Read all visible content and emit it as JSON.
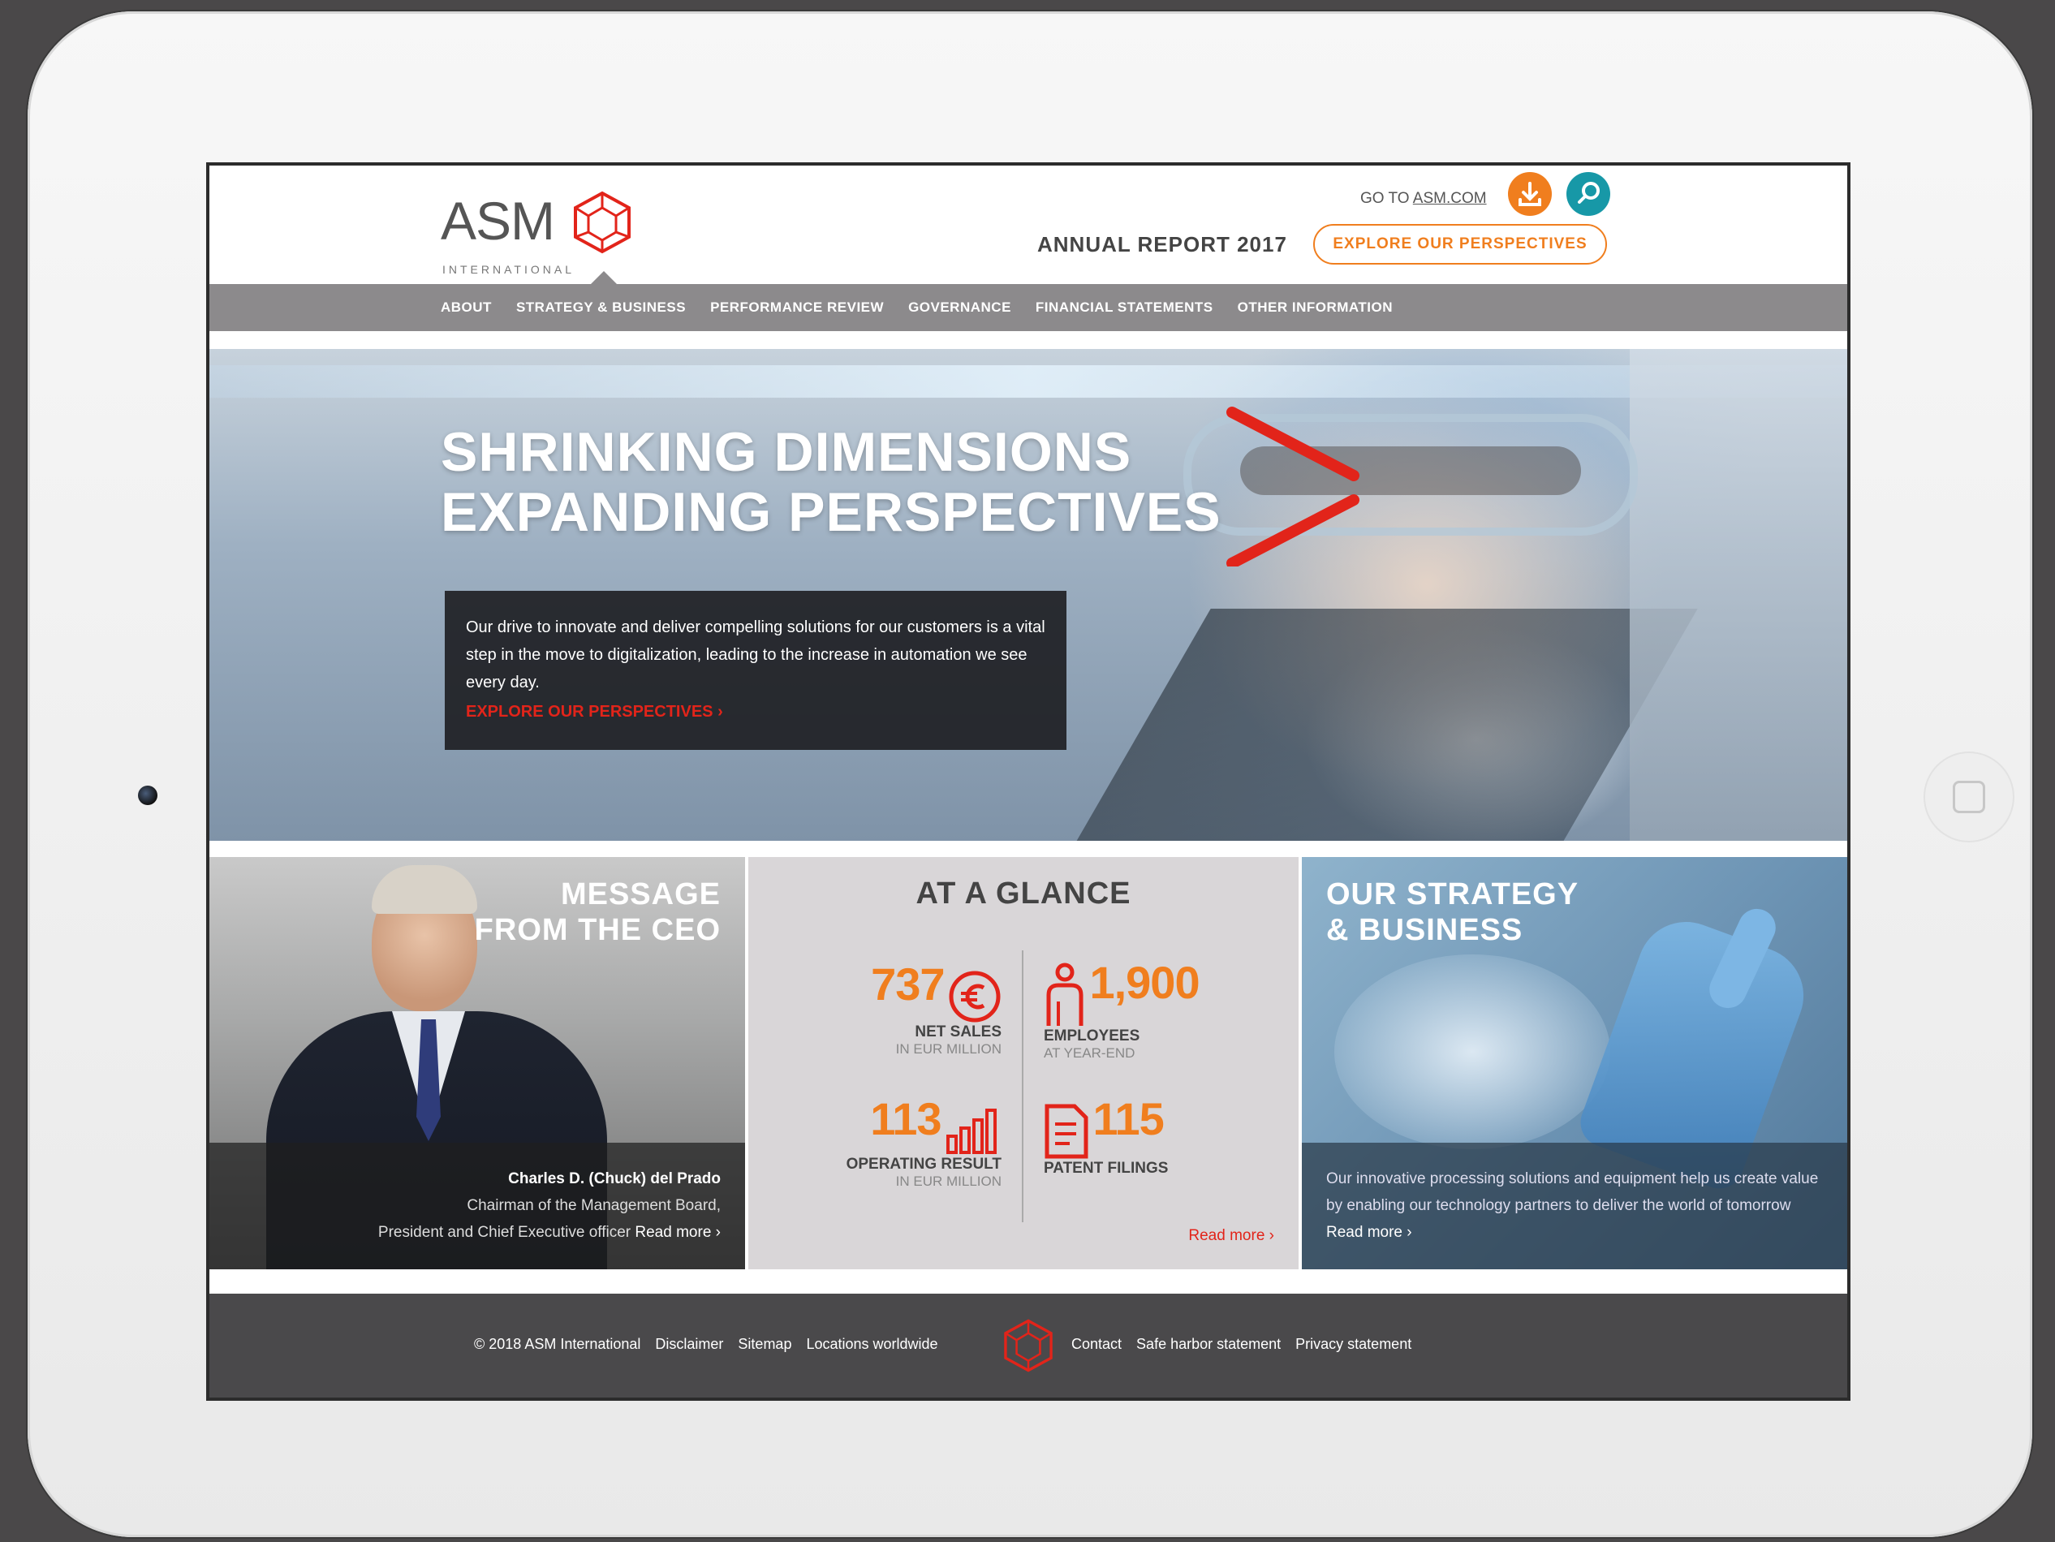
{
  "header": {
    "logo_text": "ASM",
    "logo_sub": "INTERNATIONAL",
    "goto_prefix": "GO TO",
    "goto_link": "ASM.COM",
    "annual_report": "ANNUAL REPORT 2017",
    "explore_button": "EXPLORE OUR PERSPECTIVES",
    "download_icon": "download-icon",
    "search_icon": "search-icon"
  },
  "nav": {
    "items": [
      "ABOUT",
      "STRATEGY & BUSINESS",
      "PERFORMANCE REVIEW",
      "GOVERNANCE",
      "FINANCIAL STATEMENTS",
      "OTHER INFORMATION"
    ]
  },
  "hero": {
    "title_line1": "SHRINKING DIMENSIONS",
    "title_line2": "EXPANDING PERSPECTIVES",
    "text": "Our drive to innovate and deliver compelling solutions for our customers is a vital step in the move to digitalization, leading to the increase in automation we see every day.",
    "link": "EXPLORE OUR PERSPECTIVES ›"
  },
  "ceo": {
    "title_line1": "MESSAGE",
    "title_line2": "FROM THE CEO",
    "name": "Charles D. (Chuck) del Prado",
    "role_line1": "Chairman of the Management Board,",
    "role_line2": "President and Chief Executive officer",
    "read_more": "Read more ›"
  },
  "glance": {
    "title": "AT A GLANCE",
    "stats": [
      {
        "value": "737",
        "label": "NET SALES",
        "sub": "IN EUR MILLION"
      },
      {
        "value": "1,900",
        "label": "EMPLOYEES",
        "sub": "AT YEAR-END"
      },
      {
        "value": "113",
        "label": "OPERATING RESULT",
        "sub": "IN EUR MILLION"
      },
      {
        "value": "115",
        "label": "PATENT FILINGS",
        "sub": ""
      }
    ],
    "read_more": "Read more ›"
  },
  "strategy": {
    "title_line1": "OUR STRATEGY",
    "title_line2": "& BUSINESS",
    "text": "Our innovative processing solutions and equipment help us create value by enabling our technology partners to deliver the world of tomorrow",
    "read_more": "Read more ›"
  },
  "footer": {
    "left_links": [
      "© 2018 ASM International",
      "Disclaimer",
      "Sitemap",
      "Locations worldwide"
    ],
    "right_links": [
      "Contact",
      "Safe harbor statement",
      "Privacy statement"
    ]
  },
  "colors": {
    "accent_orange": "#f07e1e",
    "accent_red": "#e2241a",
    "accent_teal": "#1798a7",
    "nav_gray": "#8c8a8c",
    "footer_gray": "#4a494b"
  }
}
